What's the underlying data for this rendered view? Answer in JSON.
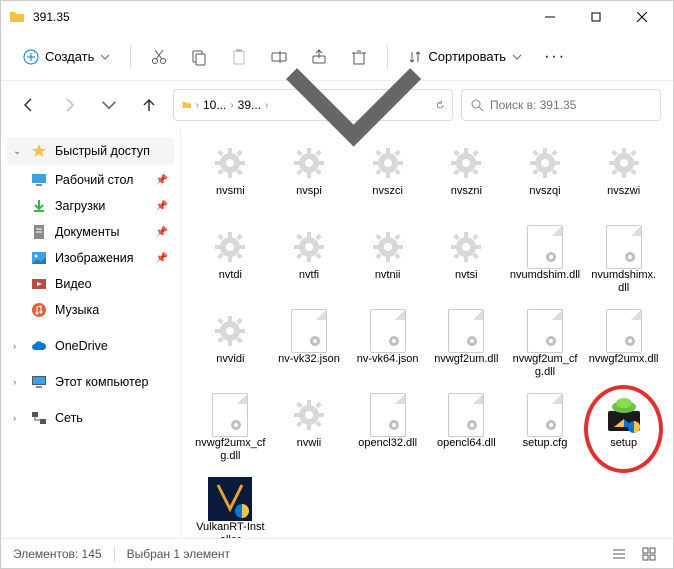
{
  "titlebar": {
    "title": "391.35"
  },
  "toolbar": {
    "new_label": "Создать",
    "sort_label": "Сортировать"
  },
  "breadcrumb": {
    "seg1": "10...",
    "seg2": "39..."
  },
  "search": {
    "placeholder": "Поиск в: 391.35"
  },
  "sidebar": {
    "quick": "Быстрый доступ",
    "desktop": "Рабочий стол",
    "downloads": "Загрузки",
    "documents": "Документы",
    "pictures": "Изображения",
    "videos": "Видео",
    "music": "Музыка",
    "onedrive": "OneDrive",
    "thispc": "Этот компьютер",
    "network": "Сеть"
  },
  "files": [
    {
      "name": "nvsmi",
      "type": "gear"
    },
    {
      "name": "nvspi",
      "type": "gear"
    },
    {
      "name": "nvszci",
      "type": "gear"
    },
    {
      "name": "nvszni",
      "type": "gear"
    },
    {
      "name": "nvszqi",
      "type": "gear"
    },
    {
      "name": "nvszwi",
      "type": "gear"
    },
    {
      "name": "nvtdi",
      "type": "gear"
    },
    {
      "name": "nvtfi",
      "type": "gear"
    },
    {
      "name": "nvtnii",
      "type": "gear"
    },
    {
      "name": "nvtsi",
      "type": "gear"
    },
    {
      "name": "nvumdshim.dll",
      "type": "dll"
    },
    {
      "name": "nvumdshimx.dll",
      "type": "dll"
    },
    {
      "name": "nvvidi",
      "type": "gear"
    },
    {
      "name": "nv-vk32.json",
      "type": "json"
    },
    {
      "name": "nv-vk64.json",
      "type": "json"
    },
    {
      "name": "nvwgf2um.dll",
      "type": "dll"
    },
    {
      "name": "nvwgf2um_cfg.dll",
      "type": "dll"
    },
    {
      "name": "nvwgf2umx.dll",
      "type": "dll"
    },
    {
      "name": "nvwgf2umx_cfg.dll",
      "type": "dll"
    },
    {
      "name": "nvwii",
      "type": "gear"
    },
    {
      "name": "opencl32.dll",
      "type": "dll"
    },
    {
      "name": "opencl64.dll",
      "type": "dll"
    },
    {
      "name": "setup.cfg",
      "type": "json"
    },
    {
      "name": "setup",
      "type": "exe",
      "highlight": true
    },
    {
      "name": "VulkanRT-Installer",
      "type": "vulkan"
    }
  ],
  "status": {
    "count_label": "Элементов: 145",
    "selected_label": "Выбран 1 элемент"
  }
}
